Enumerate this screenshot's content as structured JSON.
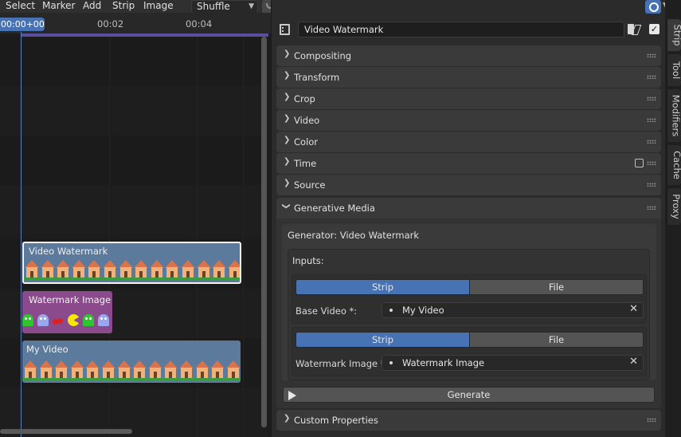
{
  "menubar": {
    "items": [
      "Select",
      "Marker",
      "Add",
      "Strip",
      "Image"
    ],
    "playback_mode": "Shuffle"
  },
  "timeline": {
    "current_frame": "00:00+00",
    "ruler_labels": [
      "00:02",
      "00:04"
    ],
    "strips": [
      {
        "name": "Video Watermark",
        "color": "#5b7a9c",
        "thumb": "houses",
        "selected": true
      },
      {
        "name": "Watermark Image",
        "color": "#8a4a8c",
        "thumb": "sprites",
        "selected": false
      },
      {
        "name": "My Video",
        "color": "#5b7a9c",
        "thumb": "houses",
        "selected": false
      }
    ]
  },
  "properties": {
    "strip_name": "Video Watermark",
    "panels": [
      "Compositing",
      "Transform",
      "Crop",
      "Video",
      "Color",
      "Time",
      "Source"
    ],
    "generative": {
      "title": "Generative Media",
      "generator_label": "Generator: Video Watermark",
      "inputs_label": "Inputs:",
      "groups": [
        {
          "tab_strip": "Strip",
          "tab_file": "File",
          "field_label": "Base Video *:",
          "value": "My Video"
        },
        {
          "tab_strip": "Strip",
          "tab_file": "File",
          "field_label": "Watermark Image *:",
          "value": "Watermark Image"
        }
      ],
      "generate_label": "Generate"
    },
    "custom_properties": "Custom Properties"
  },
  "sidebar_tabs": [
    "Strip",
    "Tool",
    "Modifiers",
    "Cache",
    "Proxy"
  ],
  "colors": {
    "accent": "#4772b3",
    "strip_video": "#5b7a9c",
    "strip_image": "#8a4a8c",
    "range_bar": "#5a4f9e"
  }
}
